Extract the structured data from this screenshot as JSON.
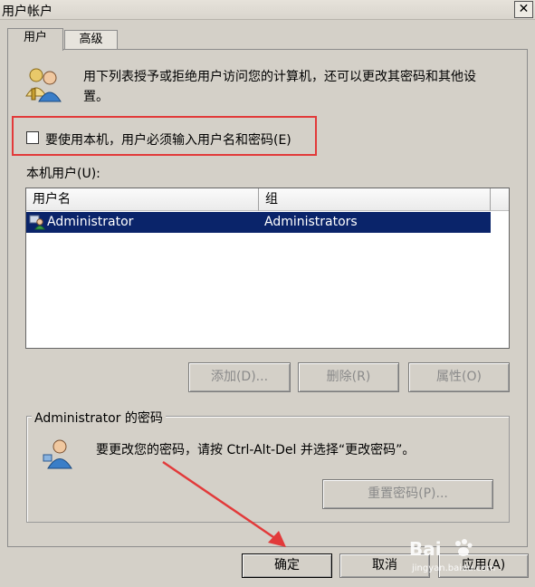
{
  "window": {
    "title": "用户帐户",
    "close": "✕"
  },
  "tabs": [
    {
      "label": "用户"
    },
    {
      "label": "高级"
    }
  ],
  "intro": {
    "line1": "用下列表授予或拒绝用户访问您的计算机，还可以更改其密码和其他设",
    "line2": "置。"
  },
  "checkbox": {
    "label": "要使用本机，用户必须输入用户名和密码(E)",
    "checked": false
  },
  "users": {
    "label": "本机用户(U):",
    "columns": [
      "用户名",
      "组"
    ],
    "rows": [
      {
        "name": "Administrator",
        "group": "Administrators"
      }
    ],
    "buttons": {
      "add": "添加(D)...",
      "remove": "删除(R)",
      "properties": "属性(O)"
    }
  },
  "password": {
    "legend": "Administrator 的密码",
    "text": "要更改您的密码，请按 Ctrl-Alt-Del 并选择“更改密码”。",
    "reset": "重置密码(P)..."
  },
  "footer": {
    "ok": "确定",
    "cancel": "取消",
    "apply": "应用(A)"
  },
  "watermark": {
    "brand": "Bai",
    "site": "jingyan.baidu.com"
  },
  "colors": {
    "selection": "#0a246a",
    "annotation": "#e23a3a"
  }
}
